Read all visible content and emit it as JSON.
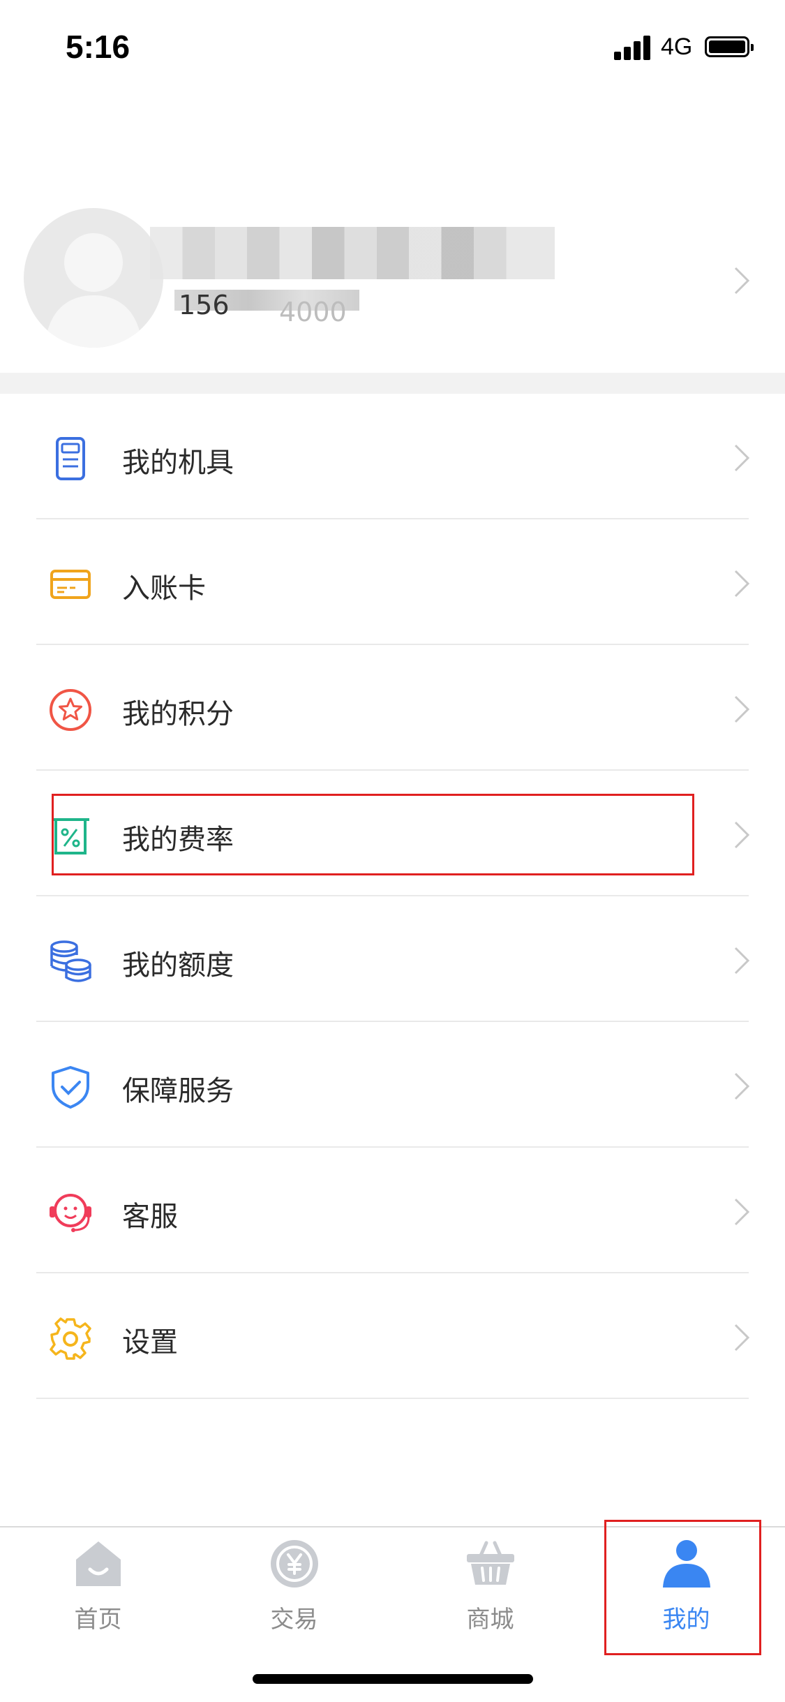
{
  "status_bar": {
    "time": "5:16",
    "network": "4G"
  },
  "profile": {
    "phone_prefix": "156",
    "phone_suffix": "4000"
  },
  "menu": {
    "items": [
      {
        "label": "我的机具",
        "icon": "pos-device-icon",
        "color": "#3b6fe0"
      },
      {
        "label": "入账卡",
        "icon": "bank-card-icon",
        "color": "#f0a41c"
      },
      {
        "label": "我的积分",
        "icon": "star-points-icon",
        "color": "#f05545"
      },
      {
        "label": "我的费率",
        "icon": "rate-receipt-icon",
        "color": "#1fb58a"
      },
      {
        "label": "我的额度",
        "icon": "coins-stack-icon",
        "color": "#3b6fe0"
      },
      {
        "label": "保障服务",
        "icon": "shield-check-icon",
        "color": "#3b86f2"
      },
      {
        "label": "客服",
        "icon": "customer-service-icon",
        "color": "#f03c5a"
      },
      {
        "label": "设置",
        "icon": "gear-icon",
        "color": "#f5b51c"
      }
    ]
  },
  "tab_bar": {
    "tabs": [
      {
        "label": "首页",
        "icon": "home-icon"
      },
      {
        "label": "交易",
        "icon": "yuan-coin-icon"
      },
      {
        "label": "商城",
        "icon": "shopping-basket-icon"
      },
      {
        "label": "我的",
        "icon": "user-icon",
        "active": true
      }
    ],
    "active_color": "#3a86f2",
    "inactive_color": "#c9ccd1"
  }
}
